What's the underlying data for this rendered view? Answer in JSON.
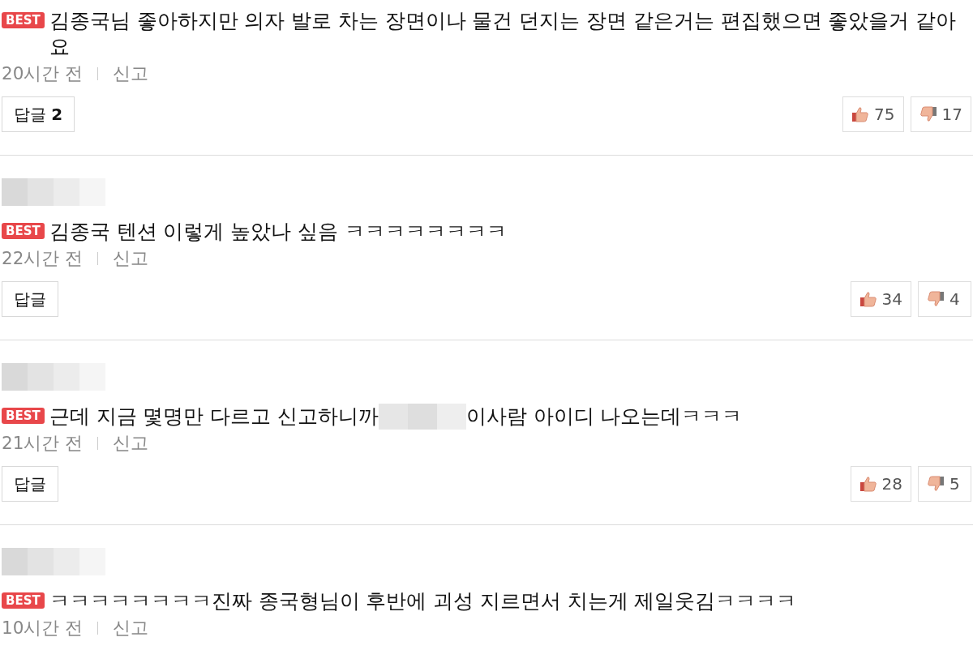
{
  "comments": [
    {
      "author_redacted": false,
      "badge": "BEST",
      "parts": [
        {
          "kind": "text",
          "text": "김종국님 좋아하지만 의자 발로 차는 장면이나 물건 던지는 장면 같은거는 편집했으면 좋았을거 같아요"
        }
      ],
      "time": "20시간 전",
      "report": "신고",
      "reply": {
        "label": "답글",
        "count": "2"
      },
      "likes": "75",
      "dislikes": "17"
    },
    {
      "author_redacted": true,
      "badge": "BEST",
      "parts": [
        {
          "kind": "text",
          "text": "김종국 텐션 이렇게 높았나 싶음 ㅋㅋㅋㅋㅋㅋㅋㅋ"
        }
      ],
      "time": "22시간 전",
      "report": "신고",
      "reply": {
        "label": "답글"
      },
      "likes": "34",
      "dislikes": "4"
    },
    {
      "author_redacted": true,
      "badge": "BEST",
      "parts": [
        {
          "kind": "text",
          "text": "근데 지금 몇명만 다르고 신고하니까"
        },
        {
          "kind": "redacted"
        },
        {
          "kind": "text",
          "text": "이사람 아이디 나오는데ㅋㅋㅋ"
        }
      ],
      "time": "21시간 전",
      "report": "신고",
      "reply": {
        "label": "답글"
      },
      "likes": "28",
      "dislikes": "5"
    },
    {
      "author_redacted": true,
      "badge": "BEST",
      "parts": [
        {
          "kind": "text",
          "text": "ㅋㅋㅋㅋㅋㅋㅋㅋ진짜 종국형님이 후반에 괴성 지르면서 치는게 제일웃김ㅋㅋㅋㅋ"
        }
      ],
      "time": "10시간 전",
      "report": "신고"
    }
  ]
}
